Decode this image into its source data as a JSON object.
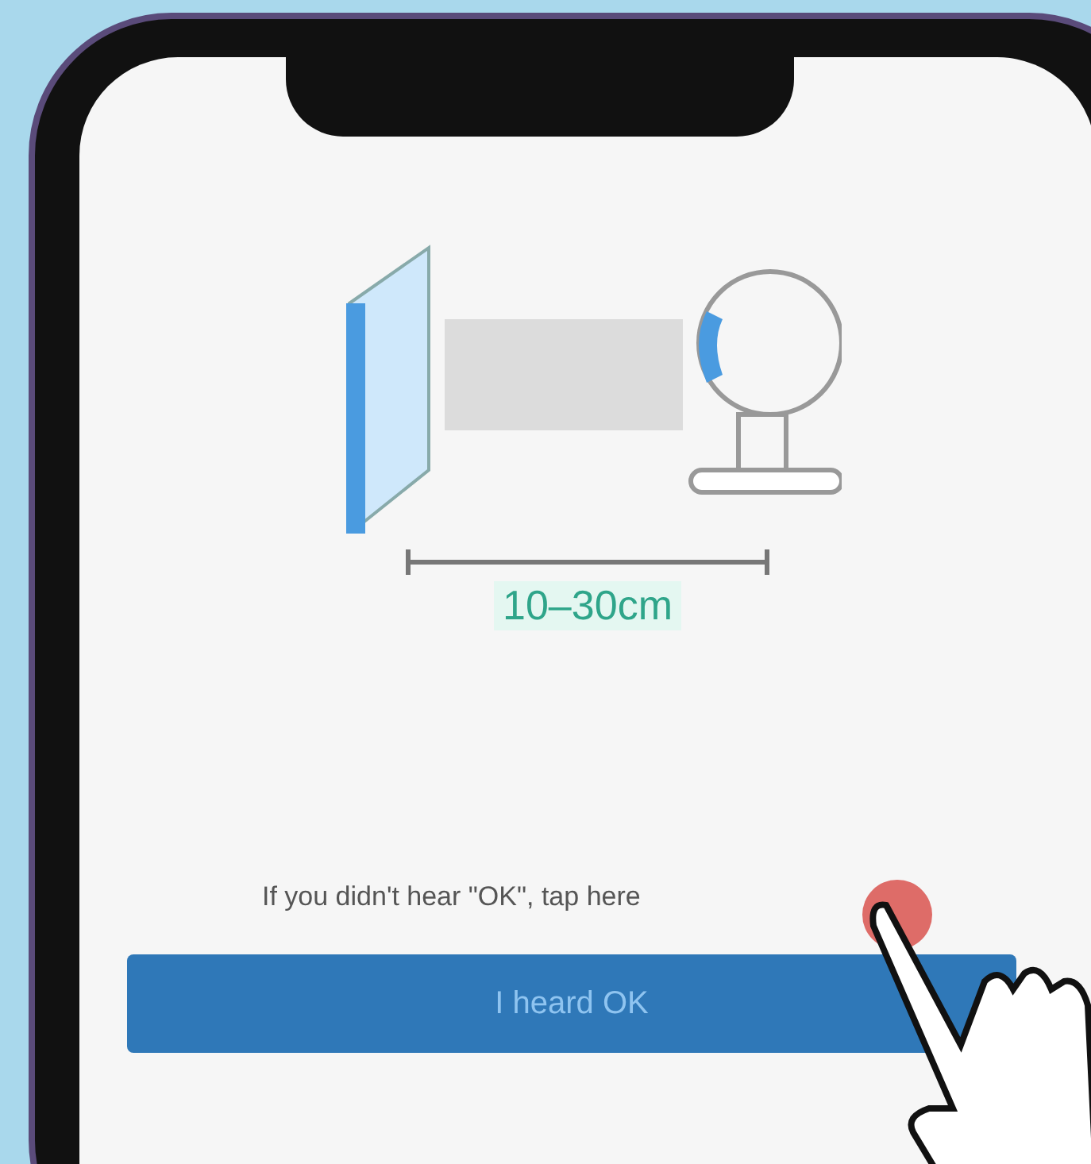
{
  "illustration": {
    "distance": "10–30cm"
  },
  "hint": {
    "text": "If you didn't hear \"OK\", tap here"
  },
  "button": {
    "label": "I heard OK"
  }
}
